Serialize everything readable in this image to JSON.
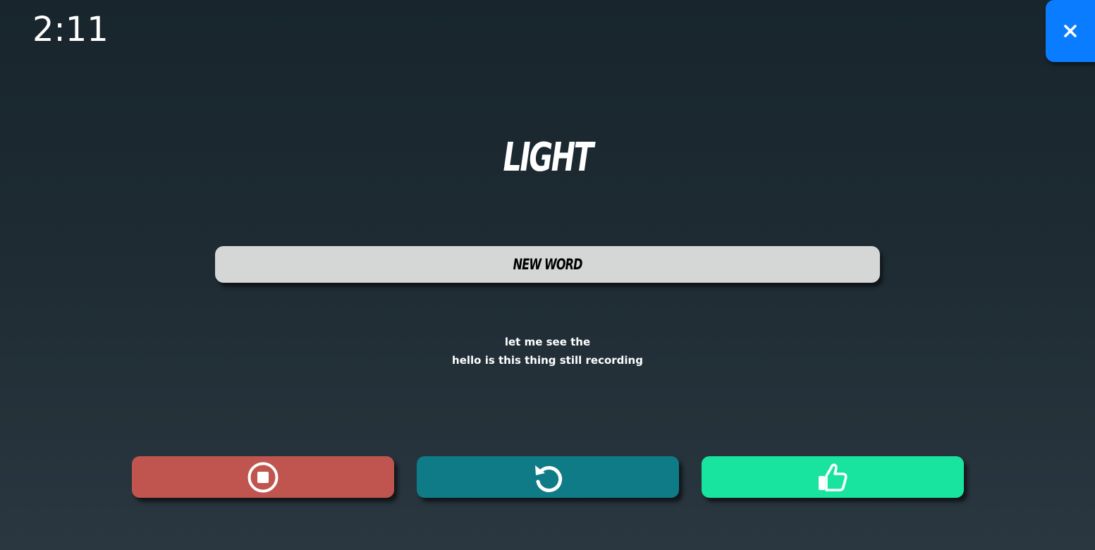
{
  "timer": {
    "value": "2:11"
  },
  "close_button": {
    "label": "×",
    "icon": "close-icon",
    "color": "#0a7cff"
  },
  "word": {
    "value": "LIGHT"
  },
  "new_word_button": {
    "label": "NEW WORD",
    "color": "#d5d6d6"
  },
  "transcript": {
    "lines": [
      "let me see the",
      "hello is this thing still recording"
    ]
  },
  "actions": [
    {
      "name": "stop",
      "icon": "stop-circle-icon",
      "color": "#bf554e"
    },
    {
      "name": "retry",
      "icon": "undo-icon",
      "color": "#0e7b87"
    },
    {
      "name": "accept",
      "icon": "thumbs-up-icon",
      "color": "#19e49f"
    }
  ]
}
